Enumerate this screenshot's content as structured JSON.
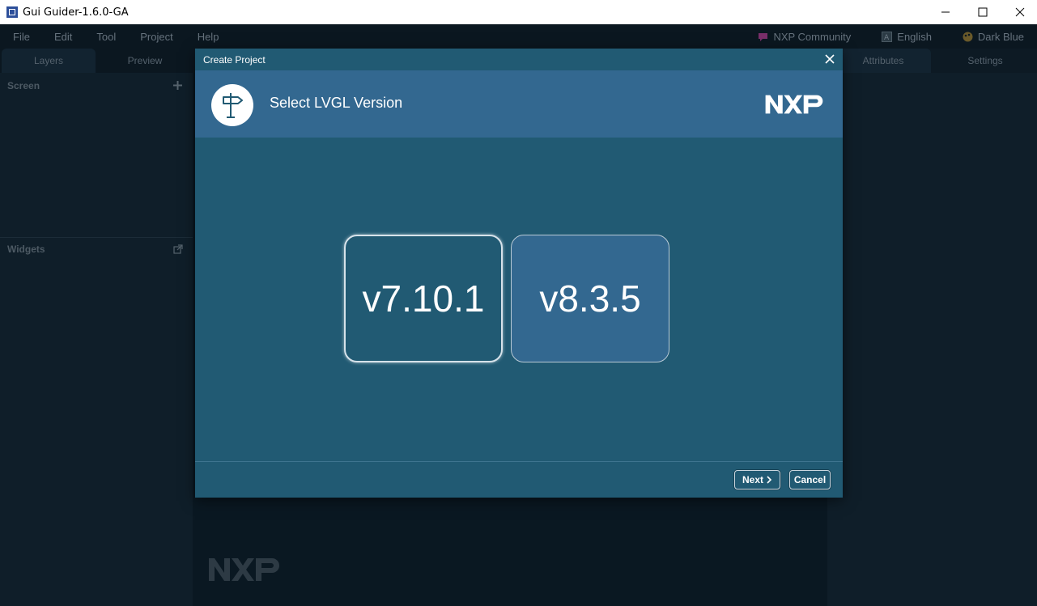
{
  "window": {
    "title": "Gui Guider-1.6.0-GA"
  },
  "menubar": {
    "items": [
      "File",
      "Edit",
      "Tool",
      "Project",
      "Help"
    ],
    "right": [
      {
        "label": "NXP Community",
        "icon": "community-icon"
      },
      {
        "label": "English",
        "icon": "language-icon"
      },
      {
        "label": "Dark Blue",
        "icon": "palette-icon"
      }
    ]
  },
  "left_panel": {
    "tabs": [
      "Layers",
      "Preview"
    ],
    "screen_label": "Screen",
    "widgets_label": "Widgets"
  },
  "right_panel": {
    "tabs": [
      "Attributes",
      "Settings"
    ]
  },
  "dialog": {
    "title": "Create Project",
    "header_title": "Select LVGL Version",
    "versions": [
      "v7.10.1",
      "v8.3.5"
    ],
    "selected_version": "v7.10.1",
    "next_label": "Next",
    "cancel_label": "Cancel"
  },
  "colors": {
    "dialog_bg": "#215a73",
    "header_bg": "#336890",
    "app_bg": "#0d1a24"
  }
}
